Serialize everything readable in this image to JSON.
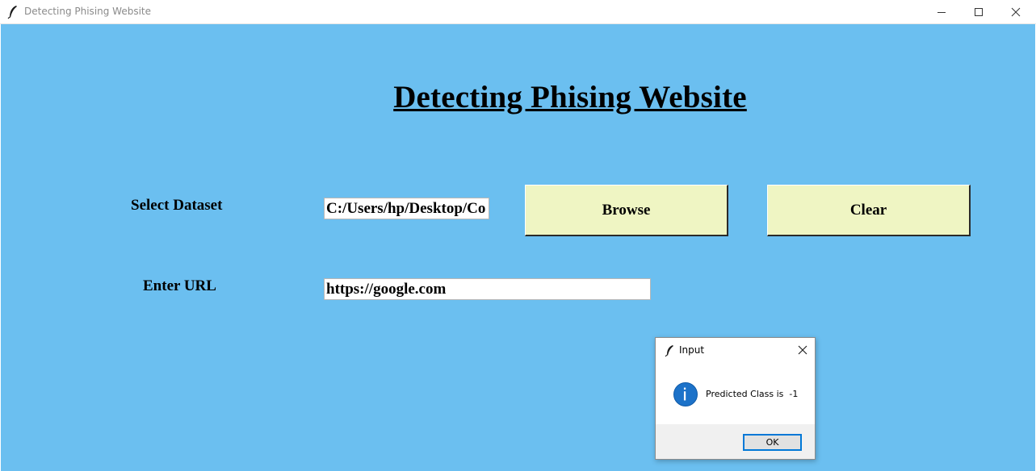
{
  "window": {
    "title": "Detecting Phising Website",
    "icon": "feather-icon"
  },
  "main": {
    "heading": "Detecting Phising Website",
    "dataset_label": "Select Dataset",
    "dataset_value": "C:/Users/hp/Desktop/Co",
    "browse_label": "Browse",
    "clear_label": "Clear",
    "url_label": "Enter URL",
    "url_value": "https://google.com"
  },
  "dialog": {
    "title": "Input",
    "message": "Predicted Class is  -1",
    "ok_label": "OK",
    "icon": "info-icon"
  },
  "colors": {
    "background": "#6bbff0",
    "button": "#eff5c3",
    "dialog_accent": "#0078d7"
  }
}
